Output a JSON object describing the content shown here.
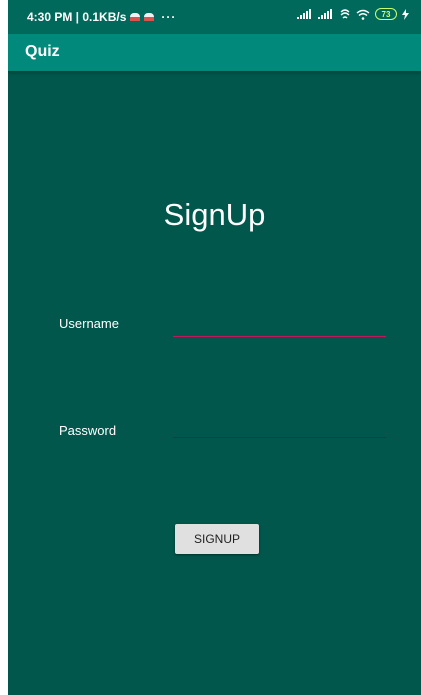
{
  "status_bar": {
    "time_and_speed": "4:30 PM | 0.1KB/s",
    "more": "···",
    "battery_level": "73",
    "icons": [
      "notification-icon",
      "notification-icon",
      "signal-icon",
      "signal-icon",
      "sync-icon",
      "wifi-icon",
      "battery-icon",
      "charging-icon"
    ]
  },
  "app_bar": {
    "title": "Quiz"
  },
  "form": {
    "title": "SignUp",
    "username_label": "Username",
    "username_value": "",
    "password_label": "Password",
    "password_value": "",
    "submit_label": "SIGNUP"
  },
  "colors": {
    "status_bar": "#00695c",
    "app_bar": "#01897b",
    "background": "#01574b",
    "username_underline": "#c2185b",
    "button": "#e0e0e0"
  }
}
